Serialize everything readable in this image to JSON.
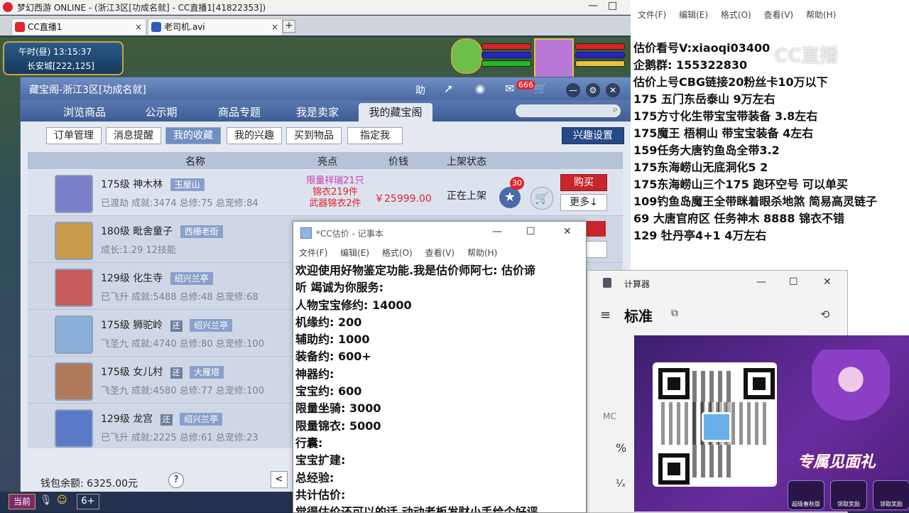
{
  "game_window": {
    "title": "梦幻西游 ONLINE - (浙江3区[功成名就] - CC直播1[41822353])",
    "min_btn": "—",
    "max_btn": "□",
    "tabs": [
      {
        "label": "CC直播1",
        "close": "×"
      },
      {
        "label": "老司机.avi",
        "close": "×"
      }
    ],
    "new_tab": "+",
    "clock_time": "午时(昼)  13:15:37",
    "clock_location": "长安城[222,125]",
    "bottom_current": "当前",
    "bottom_level": "6+"
  },
  "cbg": {
    "title": "藏宝阁-浙江3区[功成名就]",
    "help_label": "助",
    "message_badge": "666",
    "nav_tabs": [
      "浏览商品",
      "公示期",
      "商品专题",
      "我是卖家",
      "我的藏宝阁"
    ],
    "active_nav": "我的藏宝阁",
    "sub_tabs": [
      "订单管理",
      "消息提醒",
      "我的收藏",
      "我的兴趣",
      "买到物品",
      "指定我"
    ],
    "active_sub": "我的收藏",
    "interest_settings": "兴趣设置",
    "table_headers": {
      "name": "名称",
      "highlight": "亮点",
      "price": "价钱",
      "status": "上架状态"
    },
    "rows": [
      {
        "level": "175级",
        "school": "神木林",
        "tag": "玉屋山",
        "tag_extra": "",
        "info": "已渡劫 成就:3474 总修:75 总宠修:84"
      },
      {
        "level": "180级",
        "school": "毗舍童子",
        "tag": "西栅老街",
        "tag_extra": "",
        "info": "成长:1.29 12技能"
      },
      {
        "level": "129级",
        "school": "化生寺",
        "tag": "绍兴兰亭",
        "tag_extra": "",
        "info": "已飞升 成就:5488 总修:48 总宠修:68"
      },
      {
        "level": "175级",
        "school": "狮驼岭",
        "tag": "绍兴兰亭",
        "tag_extra": "还",
        "info": "飞圣九 成就:4740 总修:80 总宠修:100"
      },
      {
        "level": "175级",
        "school": "女儿村",
        "tag": "大雁塔",
        "tag_extra": "还",
        "info": "飞圣九 成就:4580 总修:77 总宠修:100"
      },
      {
        "level": "129级",
        "school": "龙宫",
        "tag": "绍兴兰亭",
        "tag_extra": "还",
        "info": "已飞升 成就:2225 总修:61 总宠修:23"
      }
    ],
    "first_row_highlight": [
      "限量祥瑞21只",
      "锦衣219件",
      "武器锦衣2件"
    ],
    "first_row_price": "￥25999.00",
    "first_row_status": "正在上架",
    "first_row_fav_count": "30",
    "buy_label": "购买",
    "more_label": "更多↓",
    "star_icon": "★",
    "cart_icon": "🛒",
    "wallet": "钱包余额: 6325.00元",
    "help": "?",
    "prev": "<"
  },
  "notepad_right": {
    "menu": [
      "文件(F)",
      "编辑(E)",
      "格式(O)",
      "查看(V)",
      "帮助(H)"
    ],
    "lines": [
      "估价看号V:xiaoqi03400",
      "企鹅群: 155322830",
      "估价上号CBG链接20粉丝卡10万以下",
      "175 五门东岳泰山  9万左右",
      "175方寸化生带宝宝带装备  3.8左右",
      "175魔王 梧桐山  带宝宝装备 4左右",
      "159任务大唐钓鱼岛全带3.2",
      "175东海崂山无底洞化5  2",
      "175东海崂山三个175 跑环空号 可以单买",
      "109钓鱼岛魔王全带眯着眼杀地煞 简易高灵链子",
      "69  大唐官府区 任务神木 8888 锦衣不错",
      "129 牡丹亭4+1 4万左右"
    ],
    "watermark": "CC直播"
  },
  "notepad": {
    "title": "*CC估价 - 记事本",
    "min": "—",
    "max": "☐",
    "close": "✕",
    "menu": [
      "文件(F)",
      "编辑(E)",
      "格式(O)",
      "查看(V)",
      "帮助(H)"
    ],
    "lines": [
      "欢迎使用好物鉴定功能.我是估价师阿七: 估价谛",
      "听 竭诚为你服务:",
      "人物宝宝修约: 14000",
      "机缘约: 200",
      "辅助约: 1000",
      "装备约: 600+",
      "神器约:",
      "宝宝约: 600",
      "限量坐骑: 3000",
      "限量锦衣: 5000",
      "行囊:",
      "宝宝扩建:",
      "总经验:",
      "共计估价:",
      "觉得估价还可以的话 动动老板发财小手给个好评"
    ]
  },
  "calculator": {
    "title": "计算器",
    "mode": "标准",
    "min": "—",
    "max": "☐",
    "close": "✕",
    "menu_icon": "≡",
    "history_icon": "⟲",
    "keep_on_top_icon": "⧉",
    "mc": "MC",
    "percent": "%",
    "inverse": "¹⁄ₓ"
  },
  "promo": {
    "title": "专属见面礼",
    "buttons": [
      "超级春秋版",
      "领取奖励",
      "领取奖励"
    ]
  }
}
